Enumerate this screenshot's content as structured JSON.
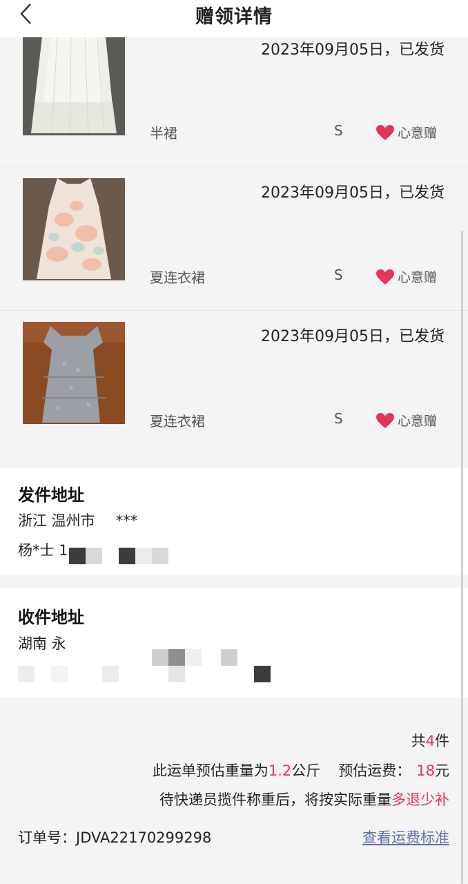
{
  "header": {
    "title": "赠领详情",
    "back_icon": "chevron-left-icon"
  },
  "items": [
    {
      "date": "2023年09月05日，已发货",
      "name": "半裙",
      "size": "S",
      "tag": "心意赠"
    },
    {
      "date": "2023年09月05日，已发货",
      "name": "夏连衣裙",
      "size": "S",
      "tag": "心意赠"
    },
    {
      "date": "2023年09月05日，已发货",
      "name": "夏连衣裙",
      "size": "S",
      "tag": "心意赠"
    }
  ],
  "sender": {
    "title": "发件地址",
    "line1": "浙江 温州市",
    "line1_tail": "***",
    "line2": "杨*士 1"
  },
  "receiver": {
    "title": "收件地址",
    "line1": "湖南 永",
    "line2": "... "
  },
  "summary": {
    "count_prefix": "共",
    "count": "4",
    "count_suffix": "件",
    "weight_prefix": "此运单预估重量为",
    "weight": "1.2",
    "weight_unit": "公斤",
    "fee_prefix": "预估运费：",
    "fee": "18",
    "fee_unit": "元",
    "note_prefix": "待快递员揽件称重后，将按实际重量",
    "note_highlight": "多退少补"
  },
  "order": {
    "label": "订单号：JDVA22170299298",
    "fee_link": "查看运费标准"
  },
  "colors": {
    "accent": "#e8325a",
    "link": "#5b73a8"
  }
}
